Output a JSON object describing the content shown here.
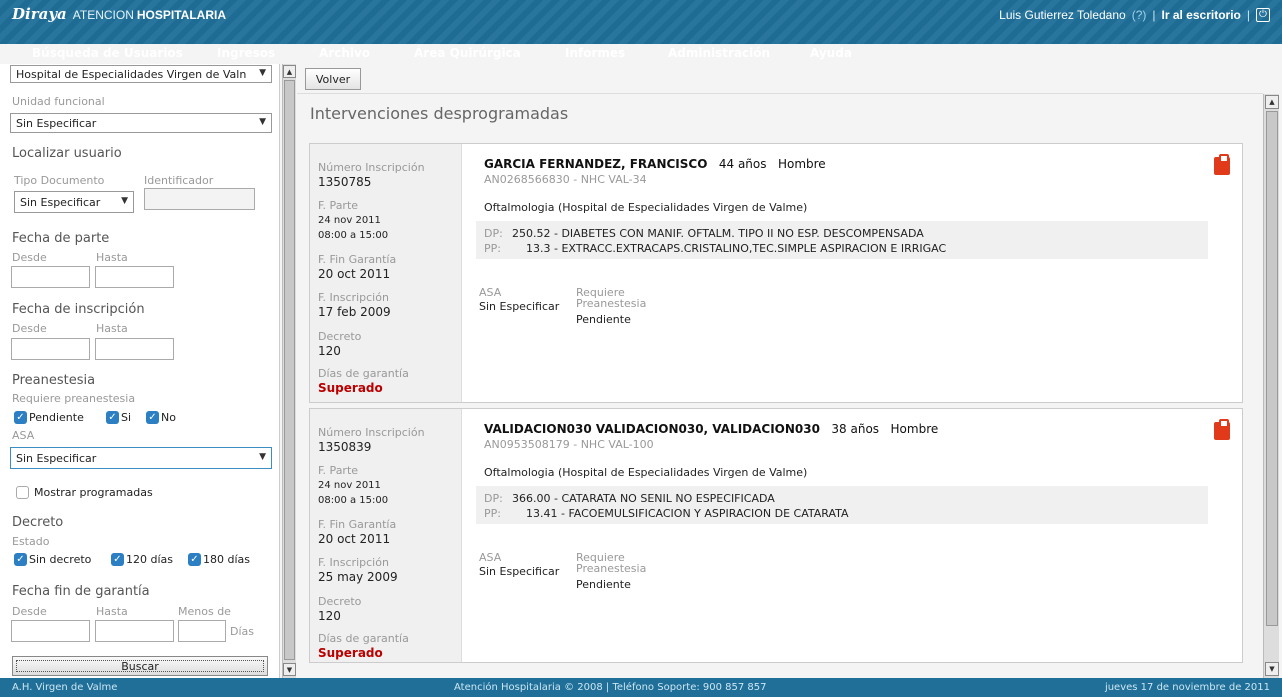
{
  "header": {
    "logo": "Diraya",
    "title_prefix": "ATENCION",
    "title_bold": "HOSPITALARIA",
    "user": "Luis Gutierrez Toledano",
    "help": "(?)",
    "sep1": "|",
    "desktop_link": "Ir al escritorio",
    "sep2": "|"
  },
  "nav": [
    "Búsqueda de Usuarios",
    "Ingresos",
    "Archivo",
    "Área Quirúrgica",
    "Informes",
    "Administración",
    "Ayuda"
  ],
  "sidebar": {
    "hospital_select": "Hospital de Especialidades Virgen de Valn",
    "unidad_label": "Unidad funcional",
    "unidad_select": "Sin Especificar",
    "localizar_label": "Localizar usuario",
    "tipo_doc_label": "Tipo Documento",
    "identificador_label": "Identificador",
    "tipo_doc_select": "Sin Especificar",
    "fecha_parte_label": "Fecha de parte",
    "fecha_parte_desde": "Desde",
    "fecha_parte_hasta": "Hasta",
    "fecha_insc_label": "Fecha de inscripción",
    "fecha_insc_desde": "Desde",
    "fecha_insc_hasta": "Hasta",
    "preanestesia_label": "Preanestesia",
    "requiere_label": "Requiere preanestesia",
    "chk_pendiente": "Pendiente",
    "chk_si": "Si",
    "chk_no": "No",
    "asa_label": "ASA",
    "asa_select": "Sin Especificar",
    "mostrar_programadas": "Mostrar programadas",
    "decreto_label": "Decreto",
    "estado_label": "Estado",
    "chk_sin_decreto": "Sin decreto",
    "chk_120": "120 días",
    "chk_180": "180 días",
    "fecha_fin_label": "Fecha fin de garantía",
    "fin_desde": "Desde",
    "fin_hasta": "Hasta",
    "fin_menos": "Menos de",
    "fin_dias": "Días",
    "buscar": "Buscar"
  },
  "main": {
    "volver": "Volver",
    "title": "Intervenciones desprogramadas",
    "cards": [
      {
        "num_label": "Número Inscripción",
        "num": "1350785",
        "parte_label": "F. Parte",
        "parte_date": "24 nov 2011",
        "parte_time": "08:00  a  15:00",
        "fin_label": "F. Fin Garantía",
        "fin": "20 oct 2011",
        "insc_label": "F. Inscripción",
        "insc": "17 feb 2009",
        "decreto_label": "Decreto",
        "decreto": "120",
        "dias_label": "Días de garantía",
        "dias": "Superado",
        "name": "GARCIA FERNANDEZ, FRANCISCO",
        "age": "44 años",
        "sex": "Hombre",
        "ids": "AN0268566830   - NHC VAL-34",
        "specialty": "Oftalmologia (Hospital de Especialidades Virgen de Valme)",
        "dp_tag": "DP:",
        "dp": "250.52 - DIABETES CON MANIF. OFTALM. TIPO II NO ESP. DESCOMPENSADA",
        "pp_tag": "PP:",
        "pp": "13.3 - EXTRACC.EXTRACAPS.CRISTALINO,TEC.SIMPLE ASPIRACION E IRRIGAC",
        "asa_label": "ASA",
        "asa": "Sin Especificar",
        "req_label_1": "Requiere",
        "req_label_2": "Preanestesia",
        "req": "Pendiente"
      },
      {
        "num_label": "Número Inscripción",
        "num": "1350839",
        "parte_label": "F. Parte",
        "parte_date": "24 nov 2011",
        "parte_time": "08:00  a  15:00",
        "fin_label": "F. Fin Garantía",
        "fin": "20 oct 2011",
        "insc_label": "F. Inscripción",
        "insc": "25 may 2009",
        "decreto_label": "Decreto",
        "decreto": "120",
        "dias_label": "Días de garantía",
        "dias": "Superado",
        "name": "VALIDACION030 VALIDACION030, VALIDACION030",
        "age": "38 años",
        "sex": "Hombre",
        "ids": "AN0953508179   - NHC VAL-100",
        "specialty": "Oftalmologia (Hospital de Especialidades Virgen de Valme)",
        "dp_tag": "DP:",
        "dp": "366.00 - CATARATA NO SENIL NO ESPECIFICADA",
        "pp_tag": "PP:",
        "pp": "13.41 - FACOEMULSIFICACION Y ASPIRACION DE CATARATA",
        "asa_label": "ASA",
        "asa": "Sin Especificar",
        "req_label_1": "Requiere",
        "req_label_2": "Preanestesia",
        "req": "Pendiente"
      }
    ]
  },
  "footer": {
    "left": "A.H. Virgen de Valme",
    "center": "Atención Hospitalaria © 2008 | Teléfono Soporte: 900 857 857",
    "right": "jueves 17 de noviembre de 2011"
  },
  "colors": {
    "brand": "#1f6f99",
    "checkbox": "#2b7fc2",
    "danger": "#b00000",
    "clipboard": "#e03a1a"
  }
}
